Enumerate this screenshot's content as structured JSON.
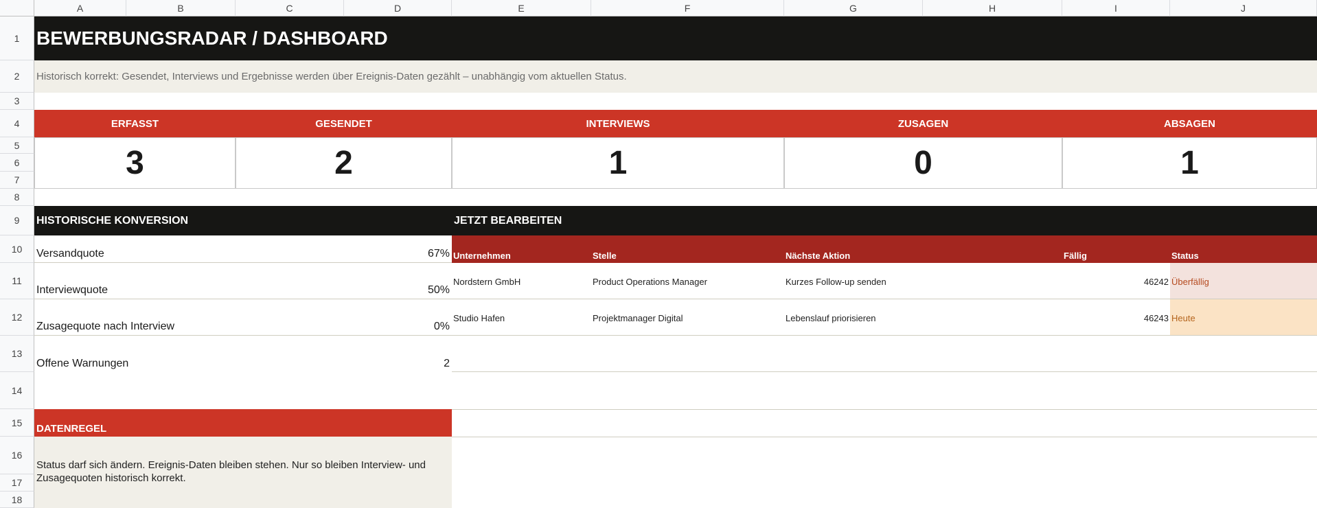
{
  "columns": [
    "A",
    "B",
    "C",
    "D",
    "E",
    "F",
    "G",
    "H",
    "I",
    "J"
  ],
  "rows": [
    "1",
    "2",
    "3",
    "4",
    "5",
    "6",
    "7",
    "8",
    "9",
    "10",
    "11",
    "12",
    "13",
    "14",
    "15",
    "16",
    "17",
    "18"
  ],
  "title": "BEWERBUNGSRADAR / DASHBOARD",
  "subtitle": "Historisch korrekt: Gesendet, Interviews und Ergebnisse werden über Ereignis-Daten gezählt – unabhängig vom aktuellen Status.",
  "kpis": [
    {
      "label": "ERFASST",
      "value": "3"
    },
    {
      "label": "GESENDET",
      "value": "2"
    },
    {
      "label": "INTERVIEWS",
      "value": "1"
    },
    {
      "label": "ZUSAGEN",
      "value": "0"
    },
    {
      "label": "ABSAGEN",
      "value": "1"
    }
  ],
  "conversion": {
    "header": "HISTORISCHE KONVERSION",
    "items": [
      {
        "label": "Versandquote",
        "value": "67%"
      },
      {
        "label": "Interviewquote",
        "value": "50%"
      },
      {
        "label": "Zusagequote nach Interview",
        "value": "0%"
      },
      {
        "label": "Offene Warnungen",
        "value": "2"
      }
    ]
  },
  "tasks": {
    "header": "JETZT BEARBEITEN",
    "columns": [
      "Unternehmen",
      "Stelle",
      "Nächste Aktion",
      "Fällig",
      "Status"
    ],
    "rows": [
      {
        "company": "Nordstern GmbH",
        "position": "Product Operations Manager",
        "action": "Kurzes Follow-up senden",
        "due": "46242",
        "status": "Überfällig",
        "status_color": "#b54a1f",
        "status_bg": "#f3e2dd"
      },
      {
        "company": "Studio Hafen",
        "position": "Projektmanager Digital",
        "action": "Lebenslauf priorisieren",
        "due": "46243",
        "status": "Heute",
        "status_color": "#b5651d",
        "status_bg": "#fbe3c5"
      }
    ]
  },
  "rule": {
    "header": "DATENREGEL",
    "text": "Status darf sich ändern. Ereignis-Daten bleiben stehen. Nur so bleiben Interview- und Zusagequoten historisch korrekt."
  },
  "colors": {
    "title_bg": "#161614",
    "accent_red": "#cc3526",
    "table_header": "#a3261f",
    "note_bg": "#f1efe8"
  }
}
